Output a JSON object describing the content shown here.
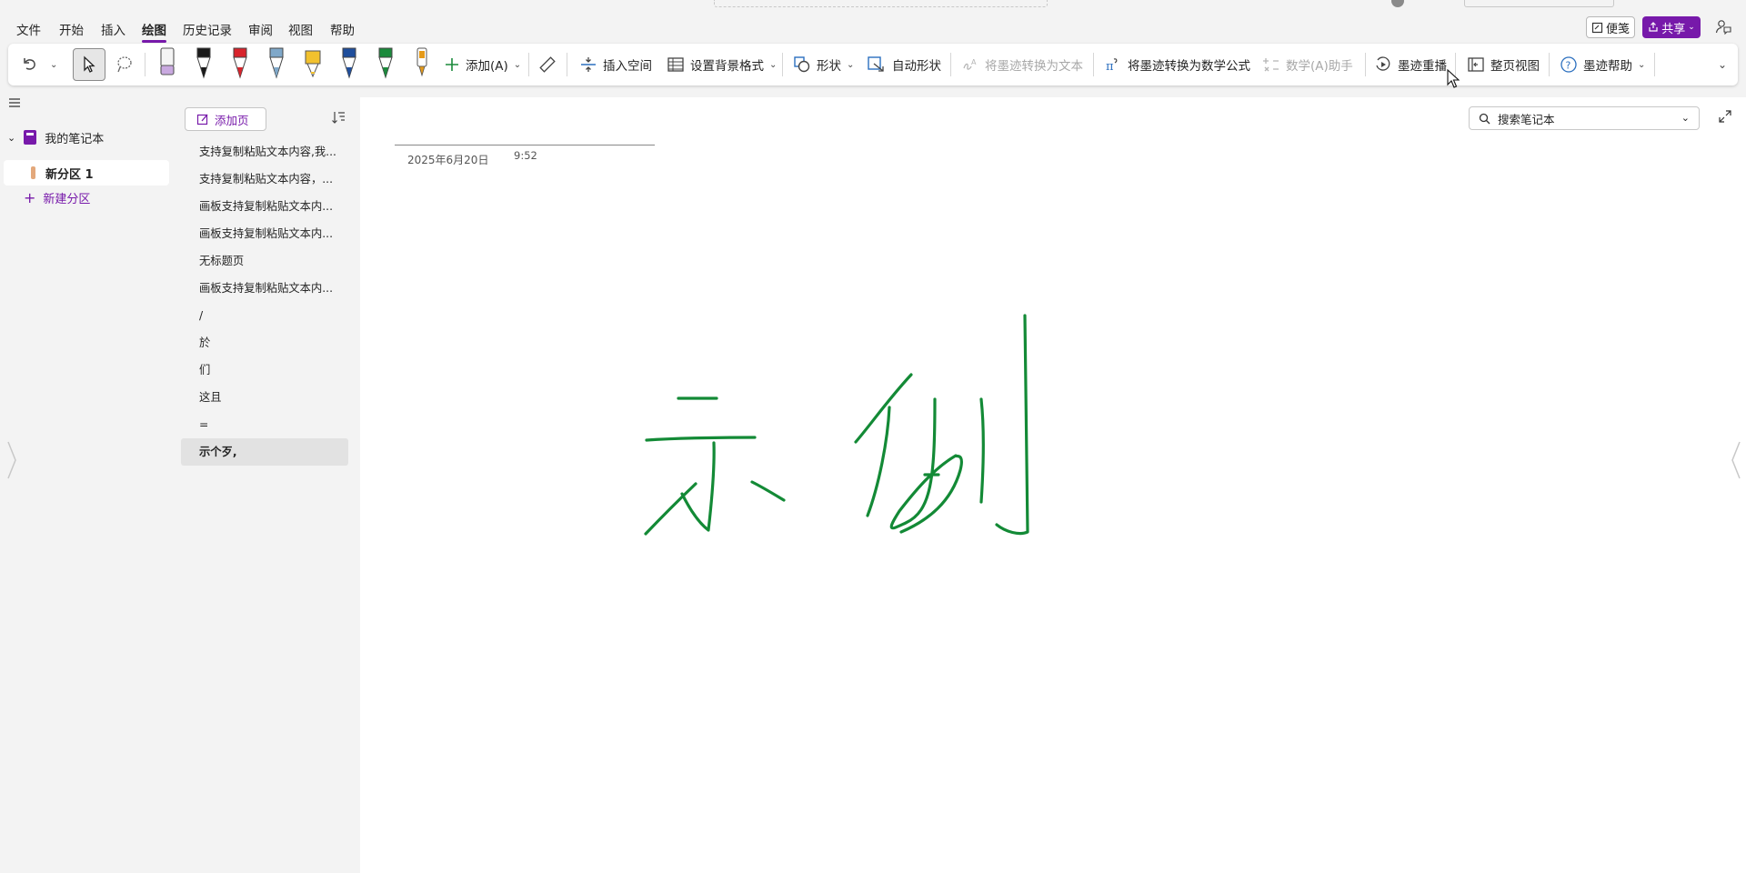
{
  "menu": {
    "items": [
      "文件",
      "开始",
      "插入",
      "绘图",
      "历史记录",
      "审阅",
      "视图",
      "帮助"
    ],
    "active": "绘图",
    "notes_label": "便笺",
    "share_label": "共享"
  },
  "ribbon": {
    "add_label": "添加(A)",
    "insert_space": "插入空间",
    "bg_format": "设置背景格式",
    "shapes": "形状",
    "auto_shapes": "自动形状",
    "ink_to_text": "将墨迹转换为文本",
    "ink_to_math": "将墨迹转换为数学公式",
    "math_assistant": "数学(A)助手",
    "ink_replay": "墨迹重播",
    "full_page_view": "整页视图",
    "ink_help": "墨迹帮助",
    "pens": [
      {
        "color": "#c9a9e0",
        "kind": "eraser"
      },
      {
        "color": "#1a1a1a",
        "kind": "pen"
      },
      {
        "color": "#d8242c",
        "kind": "pen"
      },
      {
        "color": "#7fa8c9",
        "kind": "pen"
      },
      {
        "color": "#f2c12e",
        "kind": "highlighter"
      },
      {
        "color": "#1f4e9c",
        "kind": "pen"
      },
      {
        "color": "#1b8a3c",
        "kind": "pen"
      },
      {
        "color": "#e59a1a",
        "kind": "marker"
      }
    ]
  },
  "sidebar": {
    "notebook": "我的笔记本",
    "section": "新分区 1",
    "new_section": "新建分区"
  },
  "pages": {
    "add_page": "添加页",
    "items": [
      "支持复制粘贴文本内容,我...",
      "支持复制粘贴文本内容，...",
      "画板支持复制粘贴文本内...",
      "画板支持复制粘贴文本内...",
      "无标题页",
      "画板支持复制粘贴文本内...",
      "/",
      "於",
      "们",
      "这且",
      "=",
      "示个歹,"
    ],
    "selected_index": 11
  },
  "canvas": {
    "date": "2025年6月20日",
    "time": "9:52",
    "search_placeholder": "搜索笔记本",
    "ink_color": "#138a36"
  }
}
